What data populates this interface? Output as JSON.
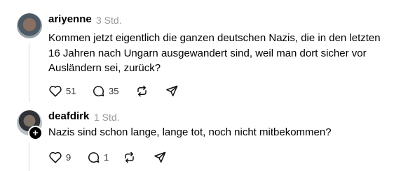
{
  "posts": [
    {
      "username": "ariyenne",
      "time": "3 Std.",
      "text": "Kommen jetzt eigentlich die ganzen deutschen Nazis, die in den letzten 16 Jahren nach Ungarn ausgewandert sind, weil man dort sicher vor Ausländern sei, zurück?",
      "likes": "51",
      "replies": "35"
    },
    {
      "username": "deafdirk",
      "time": "1 Std.",
      "text": "Nazis sind schon lange, lange tot, noch nicht mitbekommen?",
      "likes": "9",
      "replies": "1"
    }
  ]
}
